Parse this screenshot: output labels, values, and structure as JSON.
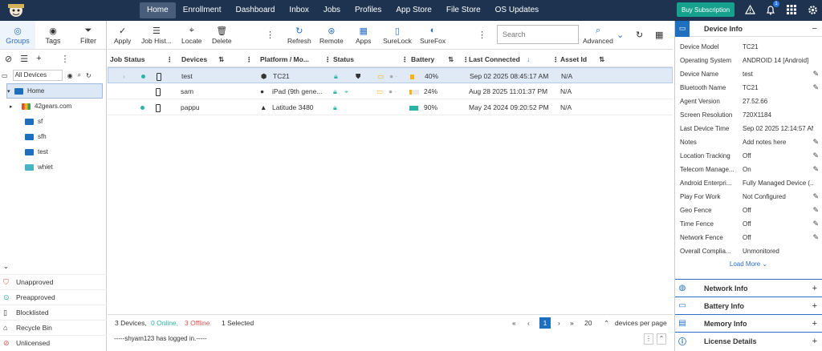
{
  "topnav": {
    "items": [
      "Home",
      "Enrollment",
      "Dashboard",
      "Inbox",
      "Jobs",
      "Profiles",
      "App Store",
      "File Store",
      "OS Updates"
    ],
    "subscription_label": "Buy Subscription",
    "notification_count": "1"
  },
  "left": {
    "tabs": [
      {
        "label": "Groups",
        "icon": "groups-icon"
      },
      {
        "label": "Tags",
        "icon": "tags-icon"
      },
      {
        "label": "Filter",
        "icon": "filter-icon"
      }
    ],
    "filter_select": "All Devices",
    "tree": [
      {
        "label": "Home",
        "color": "blue"
      },
      {
        "label": "42gears.com",
        "color": "multi"
      },
      {
        "label": "sf",
        "color": "blue"
      },
      {
        "label": "sfh",
        "color": "blue"
      },
      {
        "label": "test",
        "color": "blue"
      },
      {
        "label": "whiet",
        "color": "teal"
      }
    ],
    "bottom": [
      "Unapproved",
      "Preapproved",
      "Blocklisted",
      "Recycle Bin",
      "Unlicensed"
    ]
  },
  "toolbar": {
    "buttons": [
      "Apply",
      "Job Hist...",
      "Locate",
      "Delete",
      "Refresh",
      "Remote",
      "Apps",
      "SureLock",
      "SureFox",
      "Advanced"
    ],
    "search_placeholder": "Search"
  },
  "grid": {
    "headers": [
      "Job Status",
      "Devices",
      "Platform / Mo...",
      "Status",
      "Battery",
      "Last Connected",
      "Asset Id"
    ],
    "rows": [
      {
        "device": "test",
        "platform": "TC21",
        "battery": "40%",
        "battery_value": 40,
        "battery_color": "#f6b11c",
        "last_connected": "Sep 02 2025 08:45:17 AM",
        "asset": "N/A",
        "online": true
      },
      {
        "device": "sam",
        "platform": "iPad (9th gene...",
        "battery": "24%",
        "battery_value": 24,
        "battery_color": "#f6b11c",
        "last_connected": "Aug 28 2025 11:01:37 PM",
        "asset": "N/A",
        "online": false
      },
      {
        "device": "pappu",
        "platform": "Latitude 3480",
        "battery": "90%",
        "battery_value": 90,
        "battery_color": "#2bb3a3",
        "last_connected": "May 24 2024 09:20:52 PM",
        "asset": "N/A",
        "online": true
      }
    ]
  },
  "footer": {
    "devices_count": "3 Devices,",
    "online": "0 Online,",
    "offline": "3 Offline",
    "selected": "1 Selected",
    "page": "1",
    "per_page": "20",
    "per_page_label": "devices per page",
    "log": "-----shyam123 has logged in.-----"
  },
  "right": {
    "title": "Device Info",
    "props": [
      {
        "k": "Device Model",
        "v": "TC21",
        "edit": false
      },
      {
        "k": "Operating System",
        "v": "ANDROID 14 [Android]",
        "edit": false
      },
      {
        "k": "Device Name",
        "v": "test",
        "edit": true
      },
      {
        "k": "Bluetooth Name",
        "v": "TC21",
        "edit": true
      },
      {
        "k": "Agent Version",
        "v": "27.52.66",
        "edit": false
      },
      {
        "k": "Screen Resolution",
        "v": "720X1184",
        "edit": false
      },
      {
        "k": "Last Device Time",
        "v": "Sep 02 2025 12:14:57 AM",
        "edit": false
      },
      {
        "k": "Notes",
        "v": "Add notes here",
        "edit": true
      },
      {
        "k": "Location Tracking",
        "v": "Off",
        "edit": true
      },
      {
        "k": "Telecom Manage...",
        "v": "On",
        "edit": true
      },
      {
        "k": "Android Enterpri...",
        "v": "Fully Managed Device (...",
        "edit": false
      },
      {
        "k": "Play For Work",
        "v": "Not Configured",
        "edit": true
      },
      {
        "k": "Geo Fence",
        "v": "Off",
        "edit": true
      },
      {
        "k": "Time Fence",
        "v": "Off",
        "edit": true
      },
      {
        "k": "Network Fence",
        "v": "Off",
        "edit": true
      },
      {
        "k": "Overall Complia...",
        "v": "Unmonitored",
        "edit": false
      }
    ],
    "load_more": "Load More",
    "sections": [
      "Network Info",
      "Battery Info",
      "Memory Info",
      "License Details"
    ]
  }
}
